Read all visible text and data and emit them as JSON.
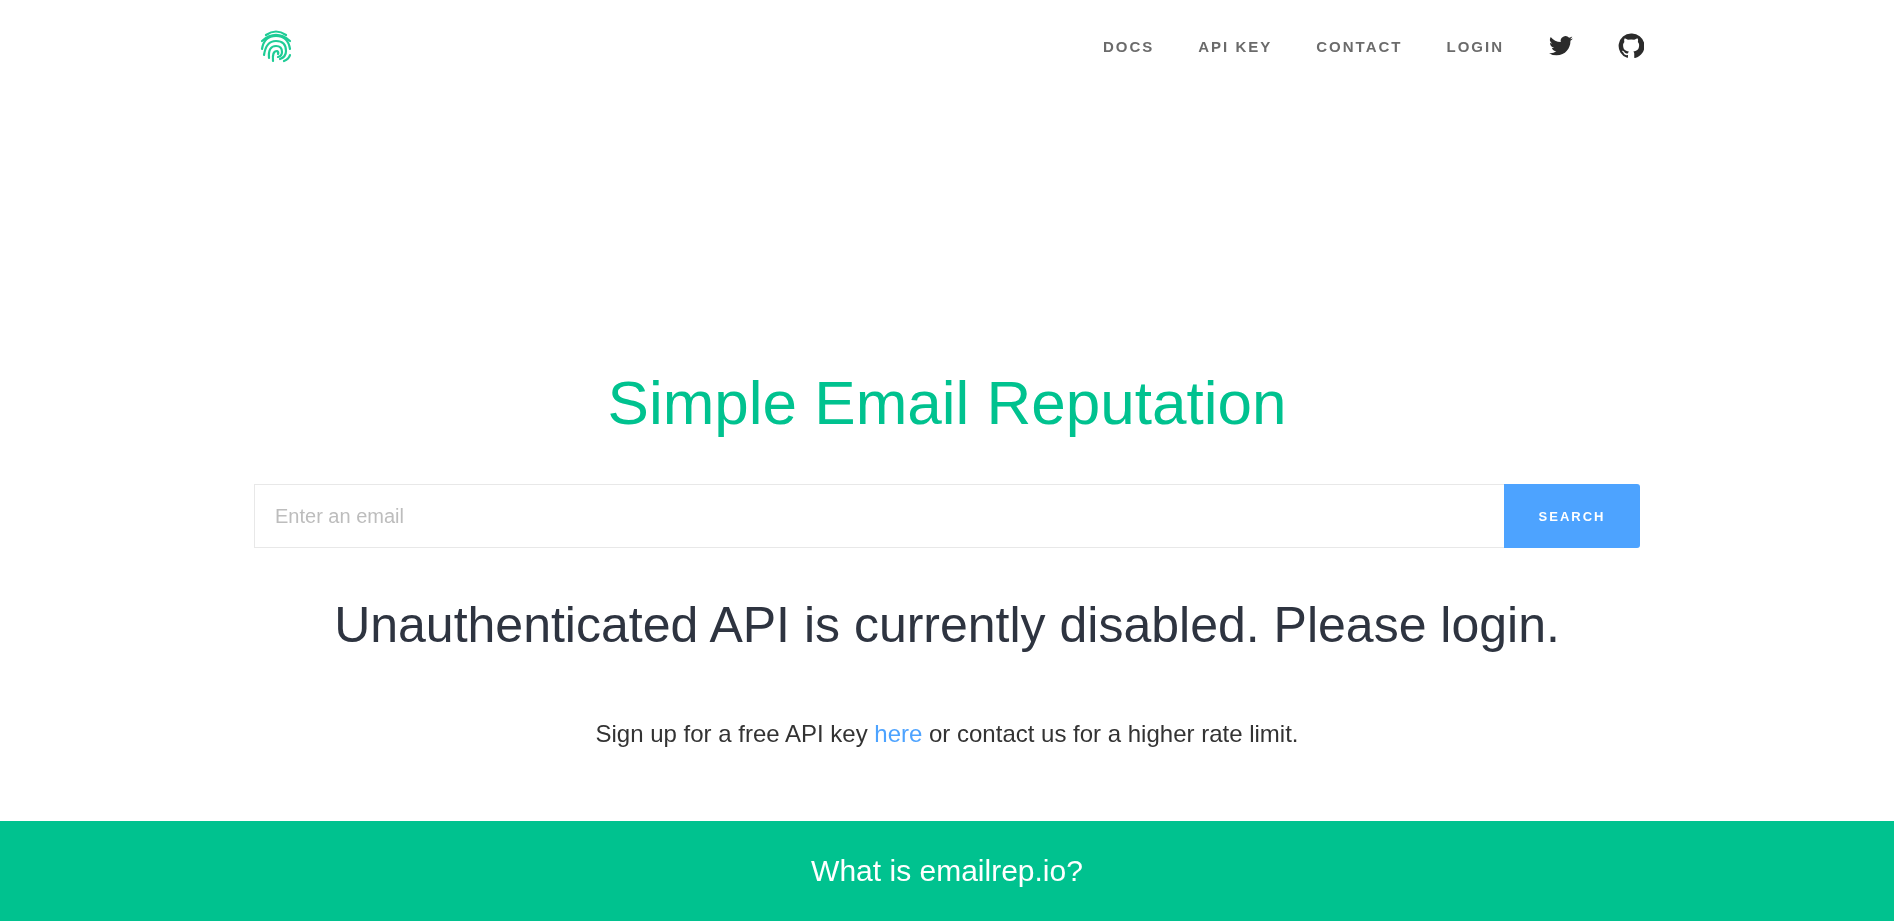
{
  "nav": {
    "items": [
      {
        "label": "DOCS"
      },
      {
        "label": "API KEY"
      },
      {
        "label": "CONTACT"
      },
      {
        "label": "LOGIN"
      }
    ]
  },
  "hero": {
    "title": "Simple Email Reputation",
    "search": {
      "placeholder": "Enter an email",
      "button": "SEARCH"
    },
    "message": "Unauthenticated API is currently disabled. Please login.",
    "note": {
      "before": "Sign up for a free API key ",
      "link": "here",
      "after": " or contact us for a higher rate limit."
    }
  },
  "footer": {
    "heading": "What is emailrep.io?"
  }
}
